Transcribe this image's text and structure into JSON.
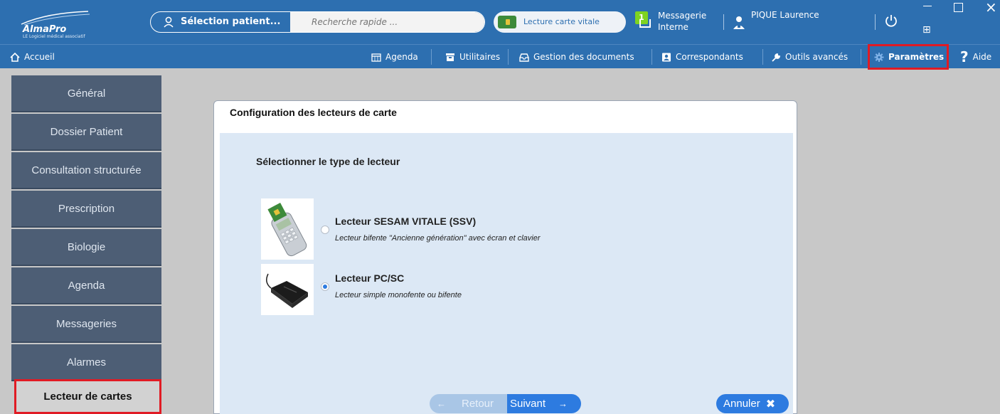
{
  "app": {
    "logo_text": "AlmaPro",
    "logo_tagline": "LE Logiciel médical associatif"
  },
  "topbar": {
    "patient_select_label": "Sélection patient...",
    "quick_search_placeholder": "Recherche rapide ...",
    "vitale_label": "Lecture carte vitale",
    "messages_count": "1",
    "messages_label": "Messagerie Interne",
    "user_name": "PIQUE Laurence",
    "window_grid_glyph": "⊞"
  },
  "menu": {
    "home": "Accueil",
    "items": [
      {
        "label": "Agenda",
        "icon": "calendar-icon"
      },
      {
        "label": "Utilitaires",
        "icon": "toolbox-icon"
      },
      {
        "label": "Gestion des documents",
        "icon": "inbox-icon"
      },
      {
        "label": "Correspondants",
        "icon": "contact-card-icon"
      },
      {
        "label": "Outils avancés",
        "icon": "wrench-icon"
      },
      {
        "label": "Paramètres",
        "icon": "gear-icon"
      },
      {
        "label": "Aide",
        "icon": "help-icon"
      }
    ]
  },
  "sidebar": {
    "items": [
      {
        "label": "Général"
      },
      {
        "label": "Dossier Patient"
      },
      {
        "label": "Consultation structurée"
      },
      {
        "label": "Prescription"
      },
      {
        "label": "Biologie"
      },
      {
        "label": "Agenda"
      },
      {
        "label": "Messageries"
      },
      {
        "label": "Alarmes"
      },
      {
        "label": "Lecteur de cartes"
      }
    ],
    "active_index": 8
  },
  "dialog": {
    "title": "Configuration des lecteurs de carte",
    "section_title": "Sélectionner le type de lecteur",
    "options": [
      {
        "title": "Lecteur SESAM VITALE (SSV)",
        "description": "Lecteur bifente  \"Ancienne génération\" avec écran et clavier",
        "selected": false
      },
      {
        "title": "Lecteur PC/SC",
        "description": "Lecteur simple monofente ou bifente",
        "selected": true
      }
    ],
    "buttons": {
      "back": "Retour",
      "next": "Suivant",
      "cancel": "Annuler"
    }
  },
  "colors": {
    "brand_blue": "#2d6fb0",
    "highlight_red": "#e01b24",
    "sidebar_bg": "#4d5e75",
    "accent_blue": "#2d7be0"
  }
}
